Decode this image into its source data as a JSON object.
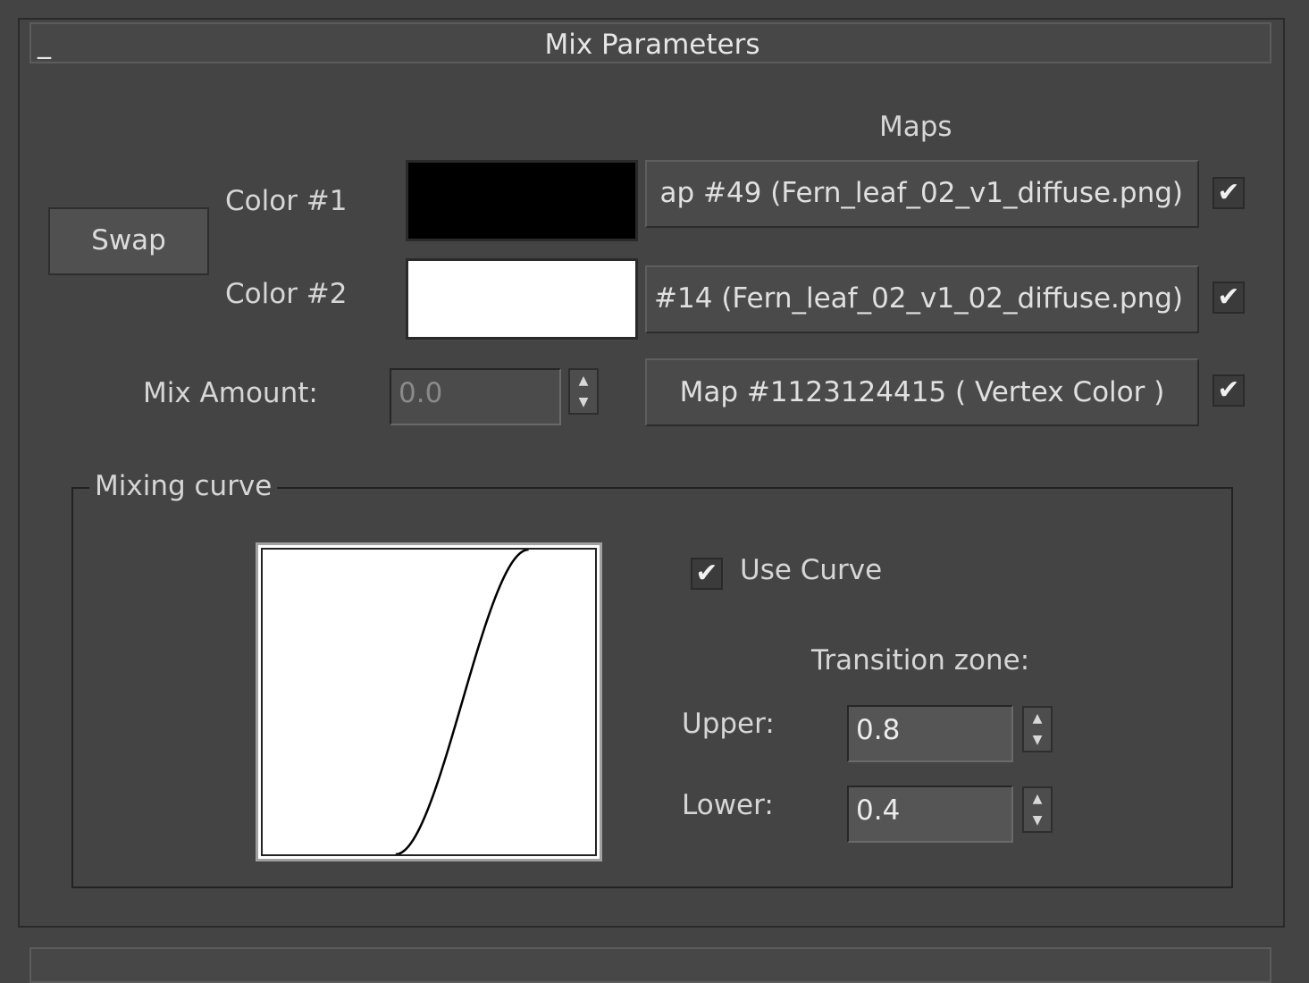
{
  "rollout": {
    "title": "Mix Parameters",
    "collapse_symbol": "_"
  },
  "maps_header": "Maps",
  "swap_label": "Swap",
  "color1": {
    "label": "Color #1",
    "swatch_color": "#000000",
    "map_label": "ap #49 (Fern_leaf_02_v1_diffuse.png)",
    "map_enabled": true
  },
  "color2": {
    "label": "Color #2",
    "swatch_color": "#ffffff",
    "map_label": "#14 (Fern_leaf_02_v1_02_diffuse.png)",
    "map_enabled": true
  },
  "mix_amount": {
    "label": "Mix Amount:",
    "value": "0.0",
    "map_label": "Map #1123124415  ( Vertex Color )",
    "map_enabled": true
  },
  "mixing_curve": {
    "group_title": "Mixing curve",
    "use_curve_label": "Use Curve",
    "use_curve_checked": true,
    "transition_zone_label": "Transition zone:",
    "upper_label": "Upper:",
    "upper_value": "0.8",
    "lower_label": "Lower:",
    "lower_value": "0.4",
    "curve_lower": 0.4,
    "curve_upper": 0.8
  },
  "check_glyph": "✔",
  "spinner_up": "▲",
  "spinner_down": "▼"
}
